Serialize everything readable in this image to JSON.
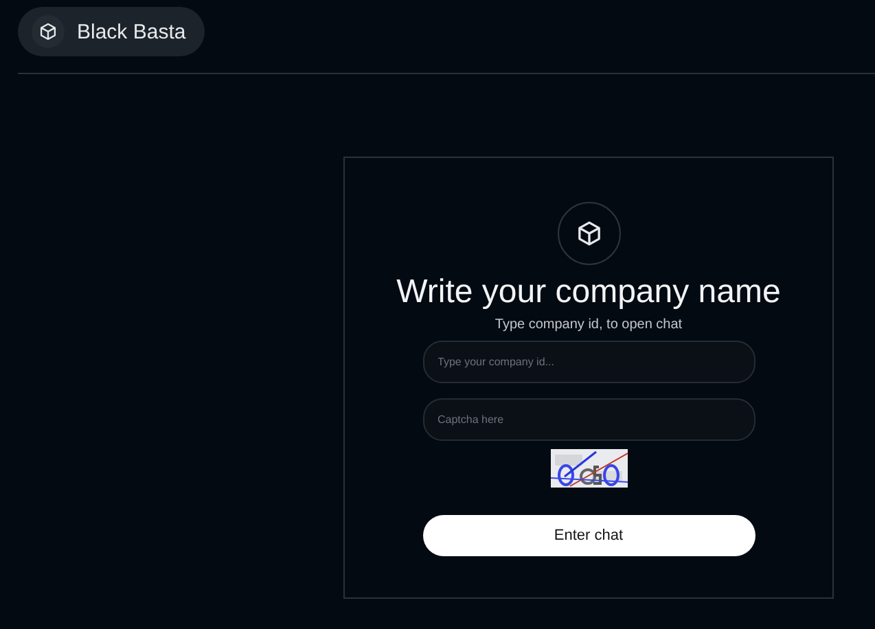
{
  "header": {
    "brand": "Black Basta"
  },
  "form": {
    "title": "Write your company name",
    "subtitle": "Type company id, to open chat",
    "fields": [
      {
        "placeholder": "Type your company id..."
      },
      {
        "placeholder": "Captcha here"
      }
    ],
    "button": "Enter chat"
  }
}
